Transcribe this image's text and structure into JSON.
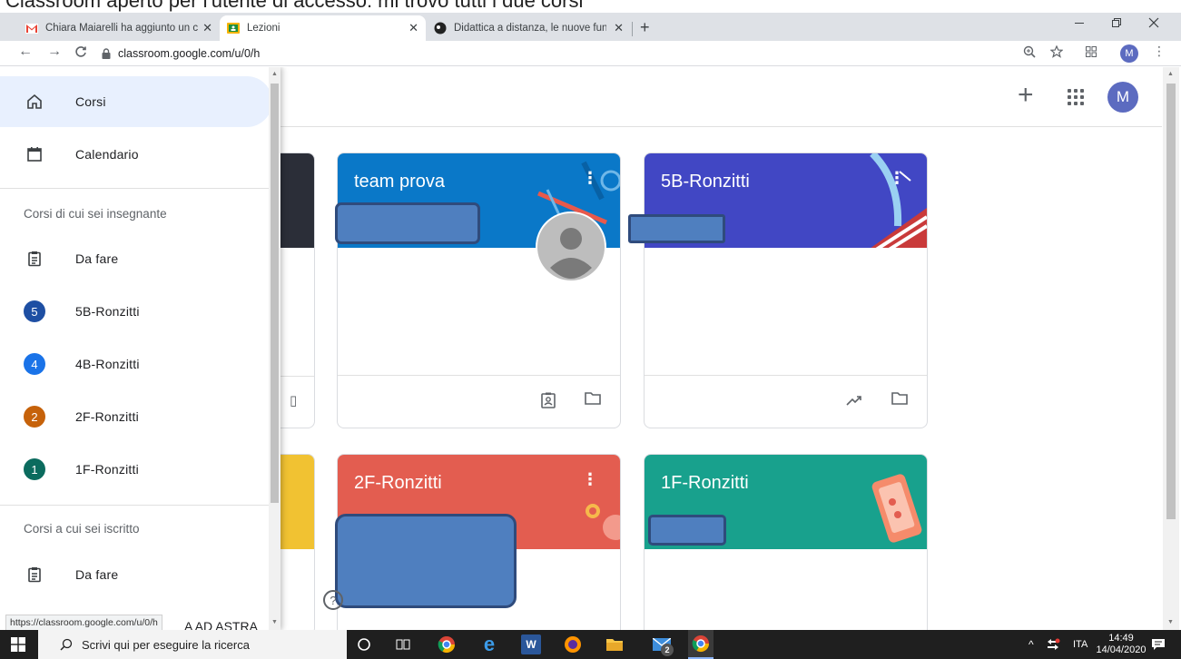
{
  "caption_text": "Classroom aperto per l'utente di accesso: mi trovo tutti i due corsi",
  "browser": {
    "tabs": [
      {
        "title": "Chiara Maiarelli ha aggiunto un c",
        "favicon": "gmail-icon",
        "active": false
      },
      {
        "title": "Lezioni",
        "favicon": "classroom-icon",
        "active": true
      },
      {
        "title": "Didattica a distanza, le nuove fun",
        "favicon": "site-icon",
        "active": false
      }
    ],
    "new_tab_label": "+",
    "close_label": "✕",
    "url": "classroom.google.com/u/0/h",
    "profile_initial": "M"
  },
  "app": {
    "avatar_initial": "M",
    "add_label": "+"
  },
  "drawer": {
    "items": [
      {
        "label": "Corsi",
        "icon": "home-icon",
        "active": true
      },
      {
        "label": "Calendario",
        "icon": "calendar-icon",
        "active": false
      }
    ],
    "teaching_section": "Corsi di cui sei insegnante",
    "teaching_todo": "Da fare",
    "teaching_courses": [
      {
        "badge": "5",
        "label": "5B-Ronzitti",
        "color": "#1e4fa3"
      },
      {
        "badge": "4",
        "label": "4B-Ronzitti",
        "color": "#1a73e8"
      },
      {
        "badge": "2",
        "label": "2F-Ronzitti",
        "color": "#c6620a"
      },
      {
        "badge": "1",
        "label": "1F-Ronzitti",
        "color": "#0b6b5e"
      }
    ],
    "enrolled_section": "Corsi a cui sei iscritto",
    "enrolled_todo": "Da fare",
    "partial_item": "A AD ASTRA"
  },
  "cards": [
    {
      "title": "team prova",
      "color": "#0a78c8"
    },
    {
      "title": "5B-Ronzitti",
      "color": "#4147c4"
    },
    {
      "title": "2F-Ronzitti",
      "color": "#e35d50"
    },
    {
      "title": "1F-Ronzitti",
      "color": "#18a18d"
    }
  ],
  "status_url": "https://classroom.google.com/u/0/h",
  "taskbar": {
    "search_placeholder": "Scrivi qui per eseguire la ricerca",
    "language": "ITA",
    "time": "14:49",
    "date": "14/04/2020",
    "badge_count": "2"
  }
}
